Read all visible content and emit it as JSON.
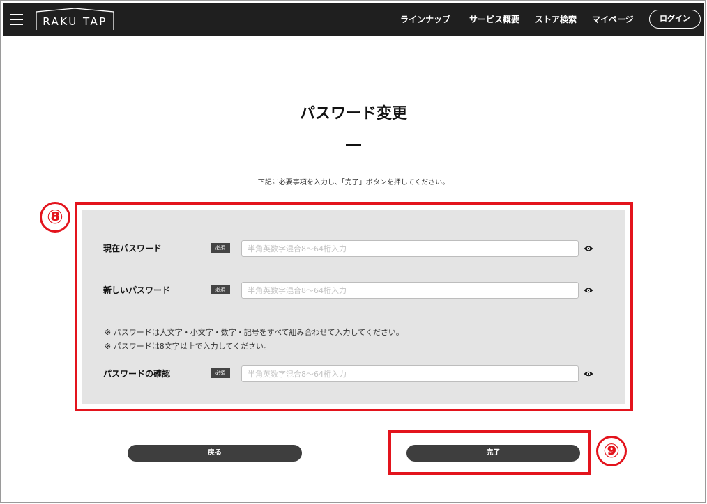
{
  "header": {
    "logo_text": "RAKU TAP",
    "nav": [
      {
        "label": "ラインナップ"
      },
      {
        "label": "サービス概要"
      },
      {
        "label": "ストア検索"
      },
      {
        "label": "マイページ"
      }
    ],
    "login_label": "ログイン"
  },
  "page": {
    "title": "パスワード変更",
    "instructions": "下記に必要事項を入力し、「完了」ボタンを押してください。"
  },
  "form": {
    "required_label": "必須",
    "current_password": {
      "label": "現在パスワード",
      "placeholder": "半角英数字混合8～64桁入力",
      "value": ""
    },
    "new_password": {
      "label": "新しいパスワード",
      "placeholder": "半角英数字混合8～64桁入力",
      "value": ""
    },
    "notes": [
      "※ パスワードは大文字・小文字・数字・記号をすべて組み合わせて入力してください。",
      "※ パスワードは8文字以上で入力してください。"
    ],
    "confirm_password": {
      "label": "パスワードの確認",
      "placeholder": "半角英数字混合8～64桁入力",
      "value": ""
    }
  },
  "buttons": {
    "back_label": "戻る",
    "complete_label": "完了"
  },
  "callouts": {
    "form_number": "⑧",
    "complete_number": "⑨"
  },
  "colors": {
    "header_bg": "#1f1f1f",
    "panel_bg": "#e4e4e4",
    "button_bg": "#3e3e3e",
    "callout_red": "#e3141d"
  },
  "icons": {
    "menu": "hamburger-menu-icon",
    "password_toggle": "eye-icon"
  }
}
